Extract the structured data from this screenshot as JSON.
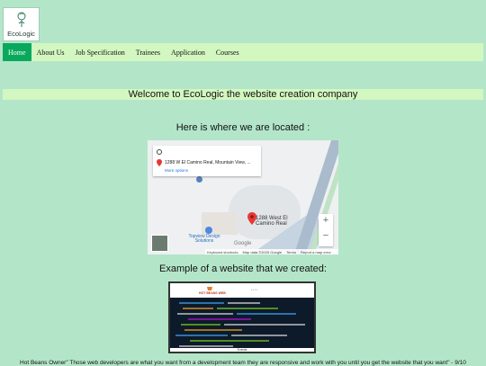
{
  "brand": {
    "logo_text": "EcoLogic",
    "logo_icon": "plant-bulb-icon"
  },
  "nav": {
    "items": [
      {
        "label": "Home",
        "active": true
      },
      {
        "label": "About Us",
        "active": false
      },
      {
        "label": "Job Specification",
        "active": false
      },
      {
        "label": "Trainees",
        "active": false
      },
      {
        "label": "Application",
        "active": false
      },
      {
        "label": "Courses",
        "active": false
      }
    ]
  },
  "welcome": "Welcome to EcoLogic the website creation company",
  "location_heading": "Here is where we are located :",
  "map": {
    "address": "1288 W El Camino Real, Mountain View, ...",
    "more_options": "More options",
    "pin_label": "1288 West El Camino Real",
    "poi_label": "Topview Design Solutions",
    "zoom_in": "+",
    "zoom_out": "−",
    "attribution": [
      "Keyboard shortcuts",
      "Map data ©2025 Google",
      "Terms",
      "Report a map error"
    ],
    "google_text": "Google"
  },
  "example_heading": "Example of a website that we created:",
  "example_site": {
    "brand": "HOT BEANS WEB",
    "footer": "Events"
  },
  "quote": "Hot Beans Owner\" Those web developers are what you want from a development team they are responsive and work with you until you get the website that you want\" - 9/10",
  "colors": {
    "background": "#b3e6c9",
    "nav_bg": "#d3f7c0",
    "active_nav": "#08a95d"
  }
}
